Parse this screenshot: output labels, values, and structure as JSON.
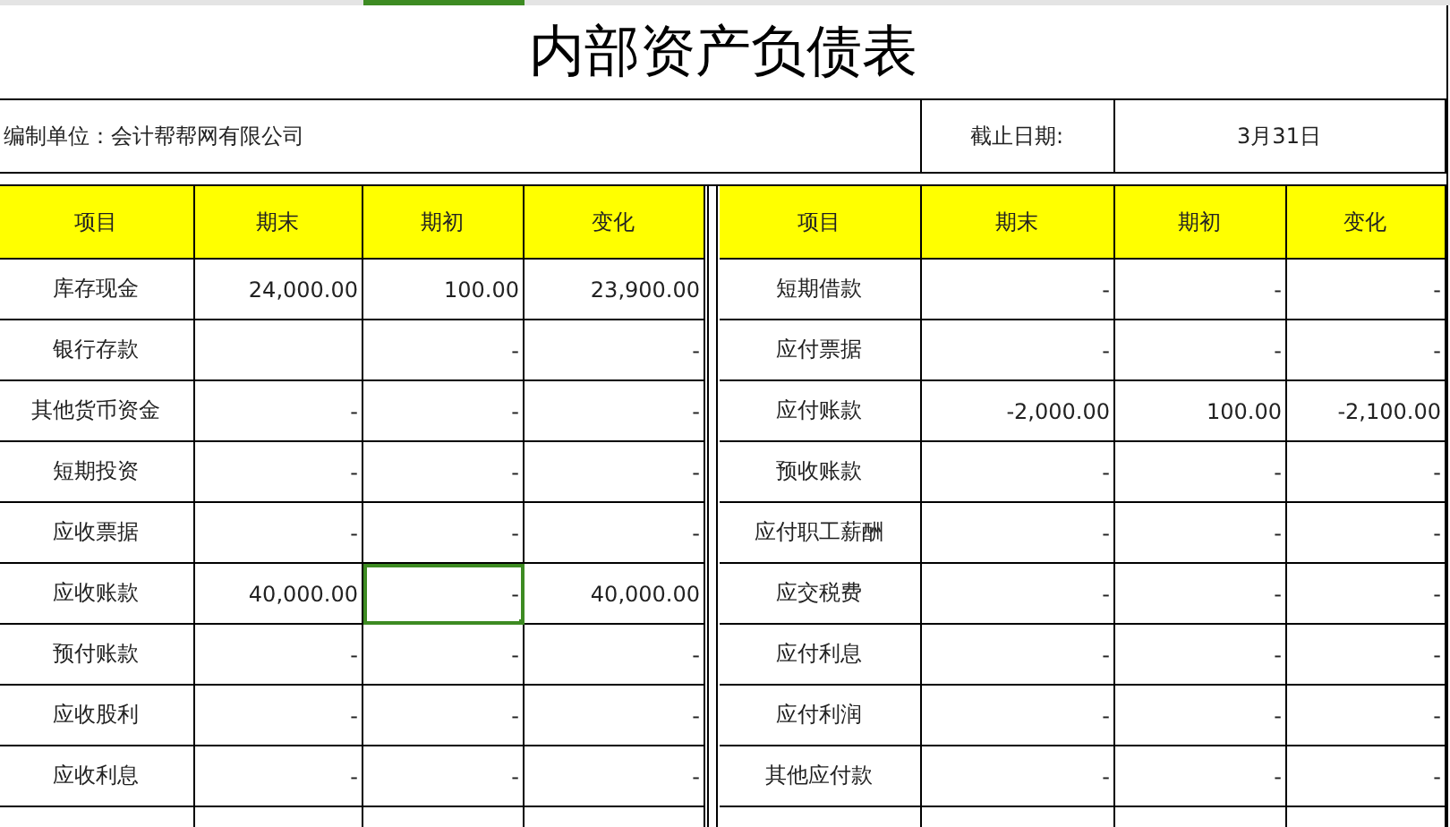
{
  "title": "内部资产负债表",
  "info": {
    "organization": "编制单位：会计帮帮网有限公司",
    "date_label": "截止日期:",
    "date_value": "3月31日"
  },
  "columns": {
    "left": [
      "项目",
      "期末",
      "期初",
      "变化"
    ],
    "right": [
      "项目",
      "期末",
      "期初",
      "变化"
    ]
  },
  "left_rows": [
    {
      "item": "库存现金",
      "closing": "24,000.00",
      "opening": "100.00",
      "change": "23,900.00",
      "opening_selected": false
    },
    {
      "item": "银行存款",
      "closing": "",
      "opening": "-",
      "change": "-",
      "opening_selected": false
    },
    {
      "item": "其他货币资金",
      "closing": "-",
      "opening": "-",
      "change": "-",
      "opening_selected": false
    },
    {
      "item": "短期投资",
      "closing": "-",
      "opening": "-",
      "change": "-",
      "opening_selected": false
    },
    {
      "item": "应收票据",
      "closing": "-",
      "opening": "-",
      "change": "-",
      "opening_selected": false
    },
    {
      "item": "应收账款",
      "closing": "40,000.00",
      "opening": "-",
      "change": "40,000.00",
      "opening_selected": true
    },
    {
      "item": "预付账款",
      "closing": "-",
      "opening": "-",
      "change": "-",
      "opening_selected": false
    },
    {
      "item": "应收股利",
      "closing": "-",
      "opening": "-",
      "change": "-",
      "opening_selected": false
    },
    {
      "item": "应收利息",
      "closing": "-",
      "opening": "-",
      "change": "-",
      "opening_selected": false
    }
  ],
  "right_rows": [
    {
      "item": "短期借款",
      "closing": "-",
      "opening": "-",
      "change": "-"
    },
    {
      "item": "应付票据",
      "closing": "-",
      "opening": "-",
      "change": "-"
    },
    {
      "item": "应付账款",
      "closing": "-2,000.00",
      "opening": "100.00",
      "change": "-2,100.00"
    },
    {
      "item": "预收账款",
      "closing": "-",
      "opening": "-",
      "change": "-"
    },
    {
      "item": "应付职工薪酬",
      "closing": "-",
      "opening": "-",
      "change": "-"
    },
    {
      "item": "应交税费",
      "closing": "-",
      "opening": "-",
      "change": "-"
    },
    {
      "item": "应付利息",
      "closing": "-",
      "opening": "-",
      "change": "-"
    },
    {
      "item": "应付利润",
      "closing": "-",
      "opening": "-",
      "change": "-"
    },
    {
      "item": "其他应付款",
      "closing": "-",
      "opening": "-",
      "change": "-"
    }
  ]
}
